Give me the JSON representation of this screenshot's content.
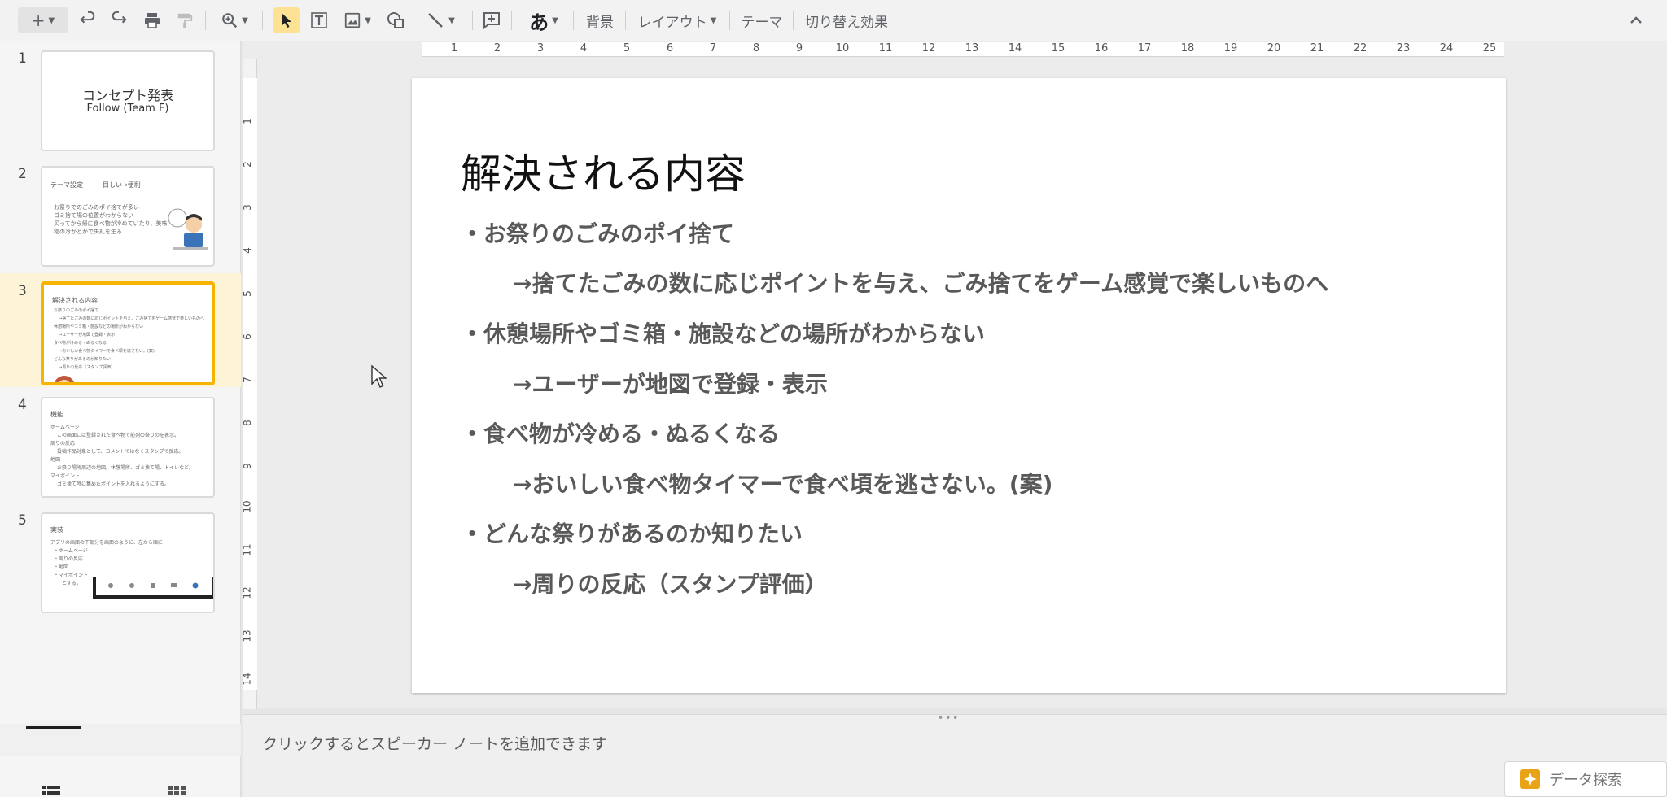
{
  "toolbar": {
    "background_label": "背景",
    "layout_label": "レイアウト",
    "theme_label": "テーマ",
    "transition_label": "切り替え効果",
    "input_mode_label": "あ"
  },
  "ruler": {
    "horizontal": [
      "1",
      "2",
      "3",
      "4",
      "5",
      "6",
      "7",
      "8",
      "9",
      "10",
      "11",
      "12",
      "13",
      "14",
      "15",
      "16",
      "17",
      "18",
      "19",
      "20",
      "21",
      "22",
      "23",
      "24",
      "25"
    ],
    "vertical": [
      "1",
      "2",
      "3",
      "4",
      "5",
      "6",
      "7",
      "8",
      "9",
      "10",
      "11",
      "12",
      "13",
      "14"
    ]
  },
  "filmstrip": {
    "slides": [
      {
        "number": "1",
        "title": "コンセプト発表",
        "subtitle": "Follow (Team F)"
      },
      {
        "number": "2",
        "head": "テーマ設定　　　目しい→便利",
        "lines": [
          "お祭りでのごみのポイ捨てが多い",
          "ゴミ捨て場の位置がわからない",
          "买ってから帰に食べ物が冷めていたり、美味物の冷かとかで失礼を生る"
        ]
      },
      {
        "number": "3",
        "head": "解決される内容",
        "lines": [
          "お祭りのごみのポイ捨て",
          "→捨てたごみの数に応じポイントを与え、ごみ捨てをゲーム感覚で楽しいものへ",
          "休憩場所やゴミ箱・施設などの場所がわからない",
          "→ユーザーが地図で登録・表示",
          "食べ物が冷める・ぬるくなる",
          "→おいしい食べ物タイマーで食べ頃を逃さない。(案)",
          "どんな祭りがあるのか知りたい",
          "→周りの反応（スタンプ評価）"
        ]
      },
      {
        "number": "4",
        "head": "機能",
        "lines": [
          "ホームページ",
          "この画面には登録された食べ物で前列の祭りのを表示。",
          "周りの反応",
          "投稿作品対象として、コメントではなくスタンプで反応。",
          "地図",
          "お祭り場所周辺の地図。休憩場所、ゴミ捨て場、トイレなど。",
          "マイポイント",
          "ゴミ捨て時に集めたポイントを入れるようにする。"
        ]
      },
      {
        "number": "5",
        "head": "実装",
        "lines": [
          "アプリの画面の下部分を画面のように、左から順に",
          "・ホームページ",
          "・周りの反応",
          "・地図",
          "・マイポイント",
          "とする。"
        ]
      }
    ]
  },
  "slide": {
    "title": "解決される内容",
    "lines": [
      {
        "text": "・お祭りのごみのポイ捨て",
        "level": 1
      },
      {
        "text": "→捨てたごみの数に応じポイントを与え、ごみ捨てをゲーム感覚で楽しいものへ",
        "level": 2
      },
      {
        "text": "・休憩場所やゴミ箱・施設などの場所がわからない",
        "level": 1
      },
      {
        "text": "→ユーザーが地図で登録・表示",
        "level": 2
      },
      {
        "text": "・食べ物が冷める・ぬるくなる",
        "level": 1
      },
      {
        "text": "→おいしい食べ物タイマーで食べ頃を逃さない。(案)",
        "level": 2
      },
      {
        "text": "・どんな祭りがあるのか知りたい",
        "level": 1
      },
      {
        "text": "→周りの反応（スタンプ評価）",
        "level": 2
      }
    ]
  },
  "notes": {
    "placeholder": "クリックするとスピーカー ノートを追加できます"
  },
  "explore": {
    "label": "データ探索"
  },
  "colors": {
    "selected_accent": "#f4b400",
    "slide_text": "#595959"
  }
}
